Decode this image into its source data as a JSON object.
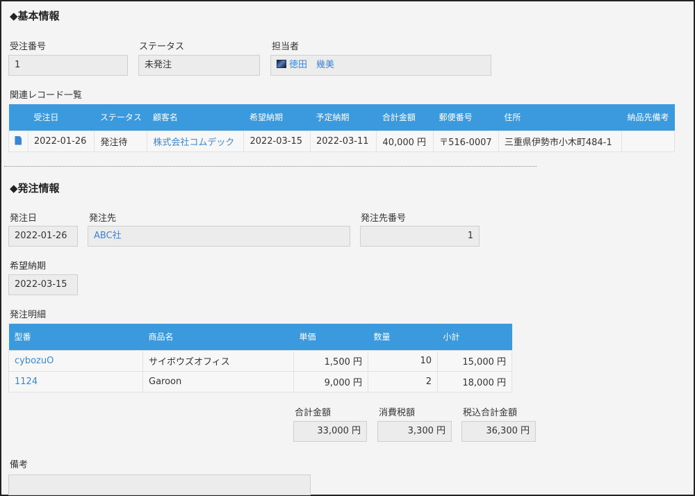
{
  "basic": {
    "title": "◆基本情報",
    "order_no_label": "受注番号",
    "order_no_value": "1",
    "status_label": "ステータス",
    "status_value": "未発注",
    "assignee_label": "担当者",
    "assignee_value": "徳田　幾美",
    "related_label": "関連レコード一覧",
    "related_table": {
      "headers": [
        "",
        "受注日",
        "ステータス",
        "顧客名",
        "希望納期",
        "予定納期",
        "合計金額",
        "郵便番号",
        "住所",
        "納品先備考"
      ],
      "rows": [
        [
          "",
          "2022-01-26",
          "発注待",
          "株式会社コムデック",
          "2022-03-15",
          "2022-03-11",
          "40,000 円",
          "〒516-0007",
          "三重県伊勢市小木町484-1",
          ""
        ]
      ]
    }
  },
  "order": {
    "title": "◆発注情報",
    "date_label": "発注日",
    "date_value": "2022-01-26",
    "supplier_label": "発注先",
    "supplier_value": "ABC社",
    "supplier_no_label": "発注先番号",
    "supplier_no_value": "1",
    "desired_label": "希望納期",
    "desired_value": "2022-03-15",
    "details_label": "発注明細",
    "details_table": {
      "headers": [
        "型番",
        "商品名",
        "単価",
        "数量",
        "小計"
      ],
      "rows": [
        [
          "cybozuO",
          "サイボウズオフィス",
          "1,500 円",
          "10",
          "15,000 円"
        ],
        [
          "1124",
          "Garoon",
          "9,000 円",
          "2",
          "18,000 円"
        ]
      ]
    },
    "total_label": "合計金額",
    "total_value": "33,000 円",
    "tax_label": "消費税額",
    "tax_value": "3,300 円",
    "grand_label": "税込合計金額",
    "grand_value": "36,300 円",
    "note_label": "備考",
    "note_value": ""
  },
  "colors": {
    "header_blue": "#3b9ade",
    "link_blue": "#3b86d4"
  }
}
